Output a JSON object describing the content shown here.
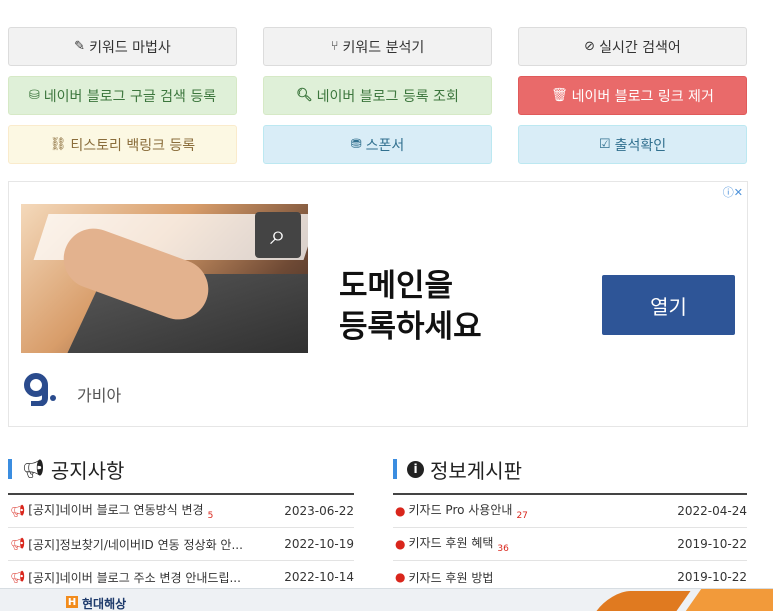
{
  "menu": {
    "keyword_wizard": "키워드 마법사",
    "keyword_analyzer": "키워드 분석기",
    "realtime_search": "실시간 검색어",
    "naver_google_register": "네이버 블로그 구글 검색 등록",
    "naver_register_check": "네이버 블로그 등록 조회",
    "naver_link_remove": "네이버 블로그 링크 제거",
    "tistory_backlink": "티스토리 백링크 등록",
    "sponsor": "스폰서",
    "attendance": "출석확인"
  },
  "ad": {
    "close": "ⓘ✕",
    "headline_line1": "도메인을",
    "headline_line2": "등록하세요",
    "open_button": "열기",
    "brand": "가비아"
  },
  "notice": {
    "title": "공지사항",
    "items": [
      {
        "title": "[공지]네이버 블로그 연동방식 변경",
        "count": "5",
        "date": "2023-06-22"
      },
      {
        "title": "[공지]정보찾기/네이버ID 연동 정상화 안...",
        "count": "",
        "date": "2022-10-19"
      },
      {
        "title": "[공지]네이버 블로그 주소 변경 안내드립...",
        "count": "",
        "date": "2022-10-14"
      }
    ]
  },
  "info": {
    "title": "정보게시판",
    "items": [
      {
        "title": "키자드 Pro 사용안내",
        "count": "27",
        "date": "2022-04-24"
      },
      {
        "title": "키자드 후원 혜택",
        "count": "36",
        "date": "2019-10-22"
      },
      {
        "title": "키자드 후원 방법",
        "count": "",
        "date": "2019-10-22"
      }
    ]
  },
  "banner": {
    "brand": "현대해상",
    "logo_letter": "H"
  },
  "colors": {
    "accent_blue": "#3b8de0",
    "red_button": "#e96a6a",
    "ad_button": "#2e5597"
  }
}
